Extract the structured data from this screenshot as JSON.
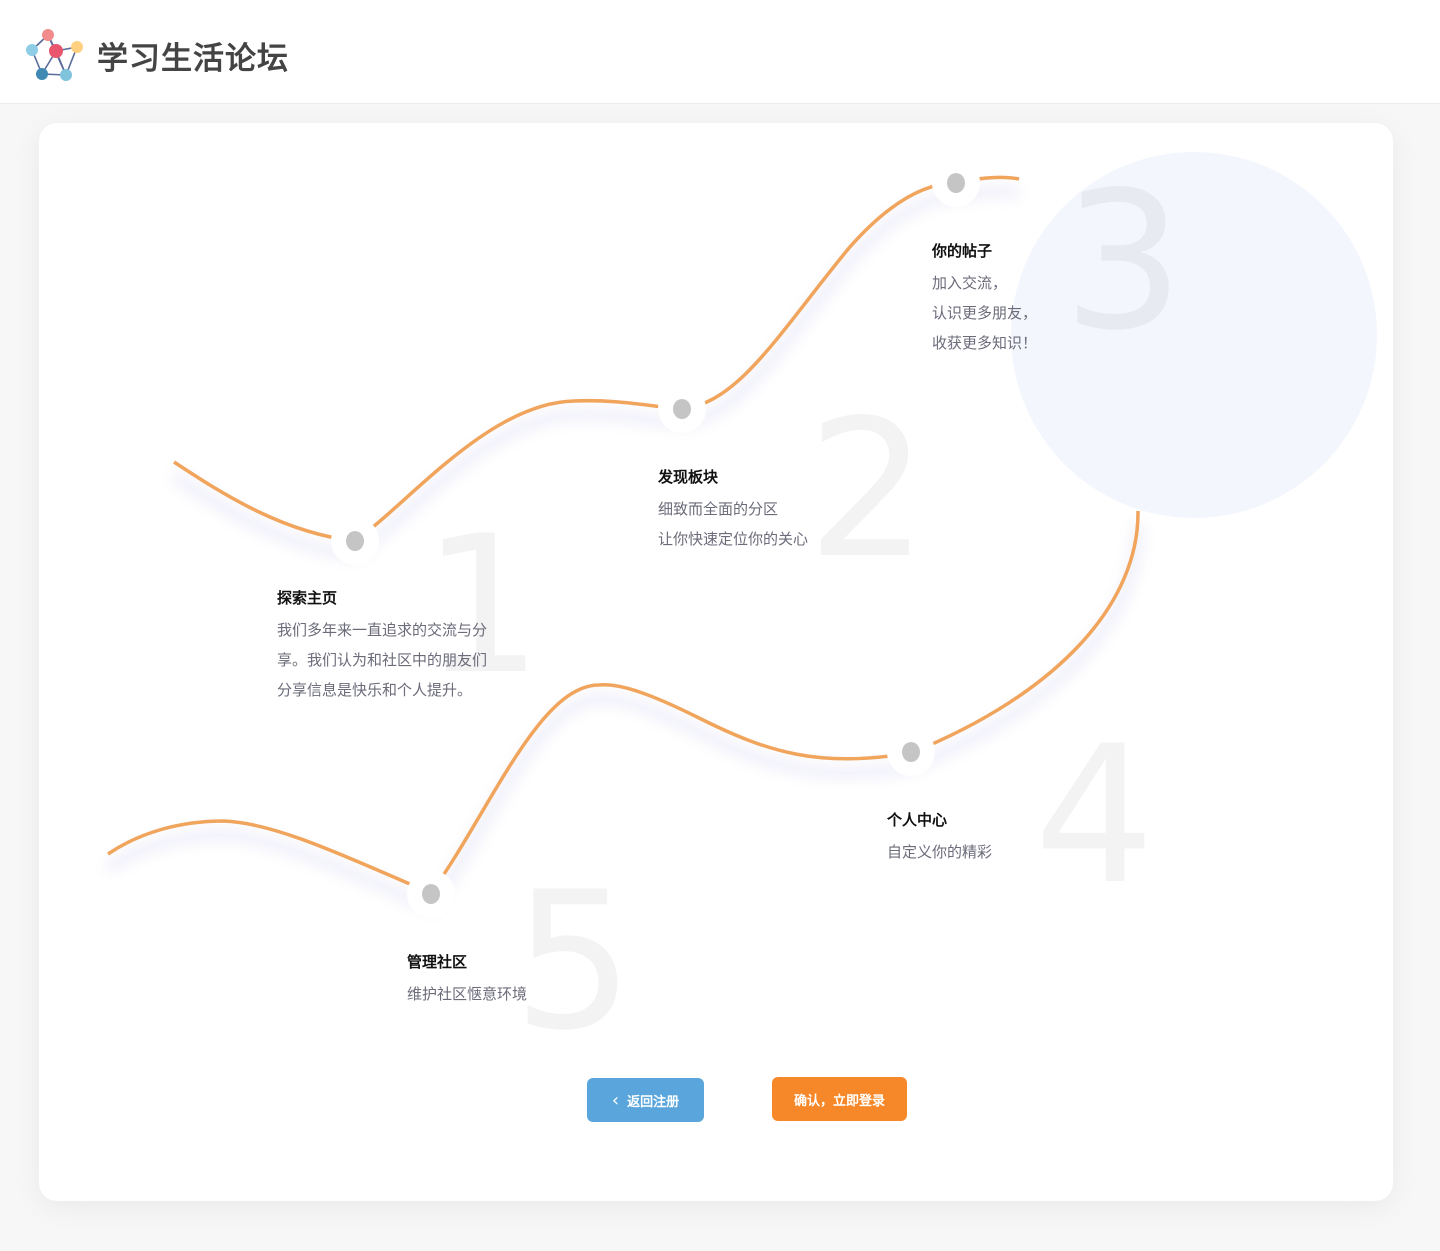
{
  "header": {
    "site_title": "学习生活论坛",
    "logo_icon": "molecule-network-logo"
  },
  "colors": {
    "path": "#f0a45c",
    "node": "#c5c5c5",
    "back_button": "#5aa6dc",
    "login_button": "#f6882a",
    "circle": "#f3f6fd"
  },
  "steps": [
    {
      "number": "1",
      "title": "探索主页",
      "lines": [
        "我们多年来一直追求的交流与分",
        "享。我们认为和社区中的朋友们",
        "分享信息是快乐和个人提升。"
      ]
    },
    {
      "number": "2",
      "title": "发现板块",
      "lines": [
        "细致而全面的分区",
        "让你快速定位你的关心"
      ]
    },
    {
      "number": "3",
      "title": "你的帖子",
      "lines": [
        "加入交流，",
        "认识更多朋友，",
        "收获更多知识！"
      ]
    },
    {
      "number": "4",
      "title": "个人中心",
      "lines": [
        "自定义你的精彩"
      ]
    },
    {
      "number": "5",
      "title": "管理社区",
      "lines": [
        "维护社区惬意环境"
      ]
    }
  ],
  "buttons": {
    "back_label": "返回注册",
    "back_icon": "chevron-left-icon",
    "login_label": "确认，立即登录"
  }
}
